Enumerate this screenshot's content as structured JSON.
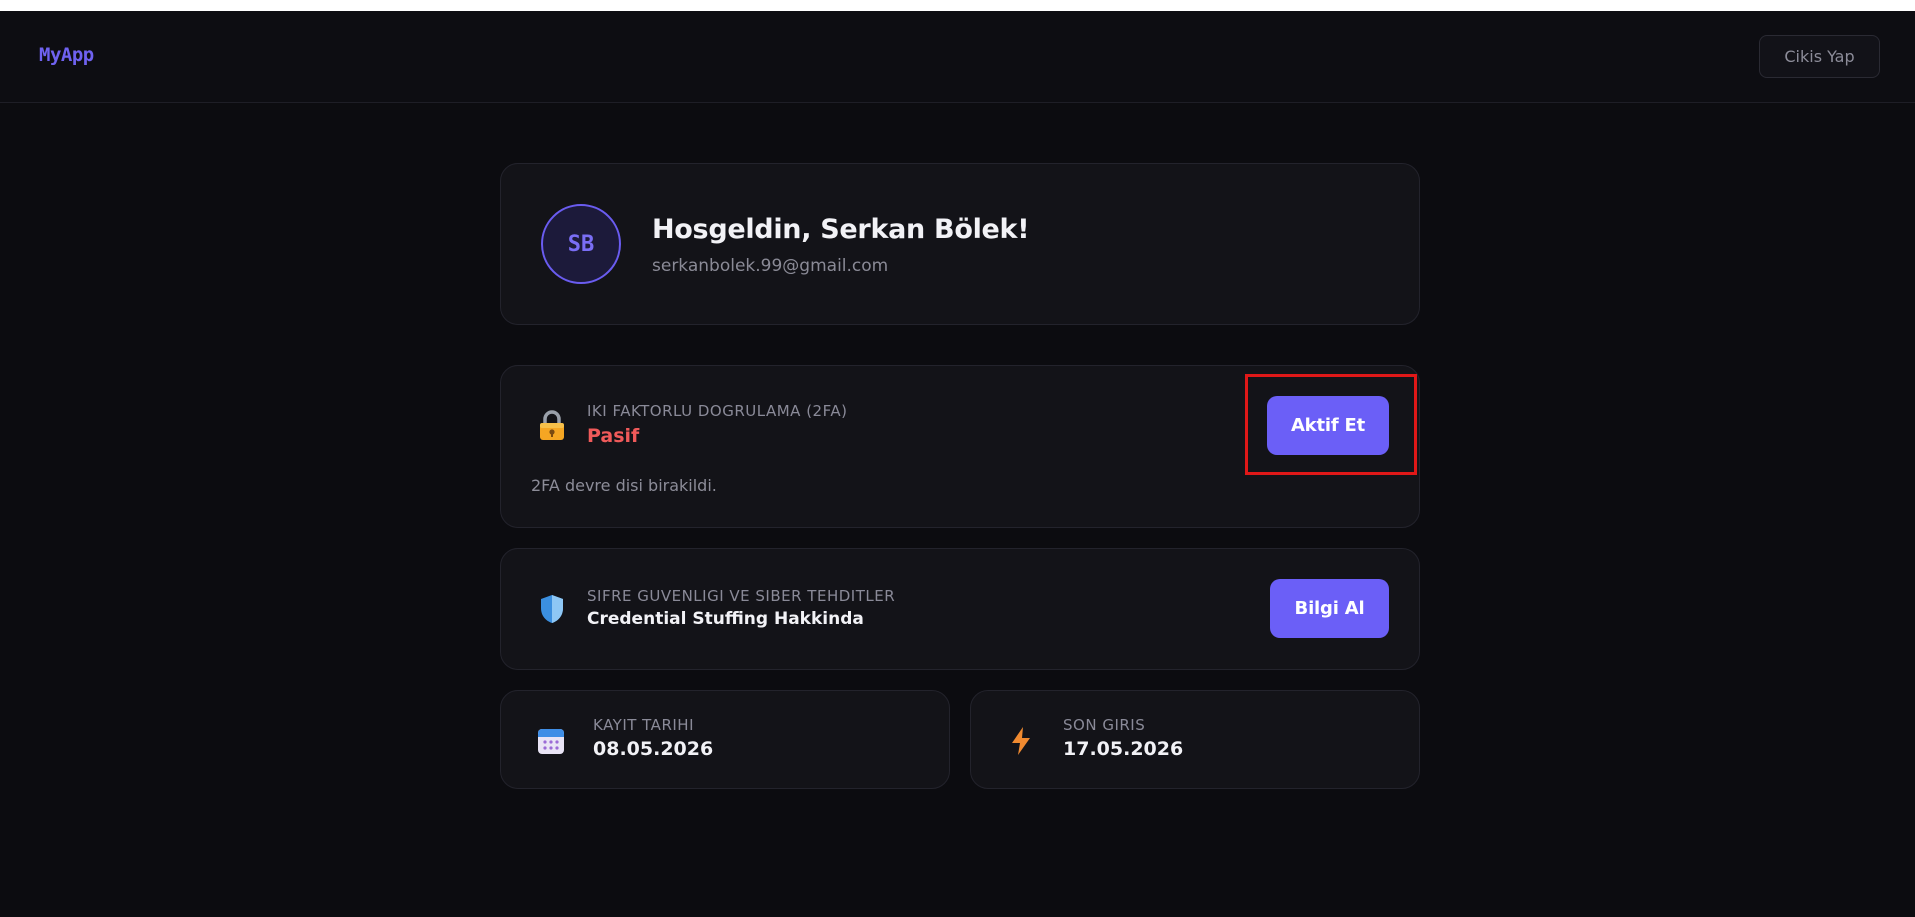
{
  "app": {
    "brand": "MyApp"
  },
  "navbar": {
    "logout_label": "Cikis Yap"
  },
  "profile": {
    "initials": "SB",
    "welcome": "Hosgeldin, Serkan Bölek!",
    "email": "serkanbolek.99@gmail.com"
  },
  "twofa": {
    "icon": "lock-icon",
    "label": "IKI FAKTORLU DOGRULAMA (2FA)",
    "status": "Pasif",
    "status_color": "#f05a5a",
    "button_label": "Aktif Et",
    "note": "2FA devre disi birakildi."
  },
  "security": {
    "icon": "shield-icon",
    "label": "SIFRE GUVENLIGI VE SIBER TEHDITLER",
    "title": "Credential Stuffing Hakkinda",
    "button_label": "Bilgi Al"
  },
  "stats": {
    "registration": {
      "icon": "calendar-icon",
      "label": "KAYIT TARIHI",
      "value": "08.05.2026"
    },
    "last_login": {
      "icon": "lightning-icon",
      "label": "SON GIRIS",
      "value": "17.05.2026"
    }
  },
  "colors": {
    "accent": "#6b5ff7",
    "background": "#0c0c10",
    "card": "#131318",
    "highlight": "#e01818"
  }
}
